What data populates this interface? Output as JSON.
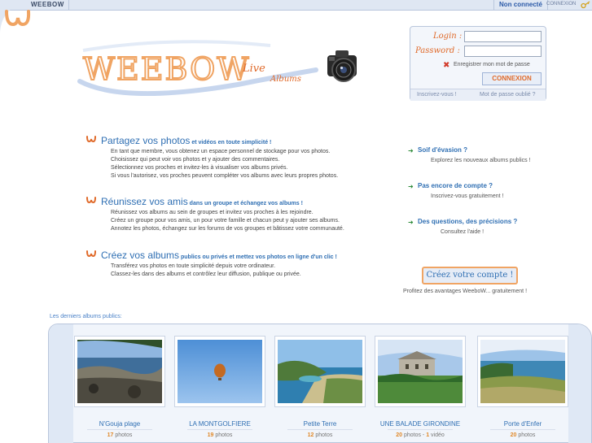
{
  "topbar": {
    "brand": "WEEBOW",
    "status": "Non connecté",
    "connect_link": "CONNEXION"
  },
  "logo": {
    "name": "WEEBOW",
    "tagline_1": "Live",
    "tagline_2": "Albums"
  },
  "login": {
    "login_label": "Login :",
    "password_label": "Password :",
    "login_value": "",
    "password_value": "",
    "remember_label": "Enregistrer mon mot de passe",
    "submit_label": "CONNEXION",
    "register_link": "Inscrivez-vous !",
    "forgot_link": "Mot de passe oublié ?"
  },
  "features": [
    {
      "title": "Partagez vos photos",
      "subtitle": " et vidéos en toute simplicité !",
      "lines": [
        "En tant que membre, vous obtenez un espace personnel de stockage pour vos photos.",
        "Choisissez qui peut voir vos photos et y ajouter des commentaires.",
        "Sélectionnez vos proches et invitez-les à visualiser vos albums privés.",
        "Si vous l'autorisez, vos proches peuvent compléter vos albums avec leurs propres photos."
      ]
    },
    {
      "title": "Réunissez vos amis",
      "subtitle": " dans un groupe et échangez vos albums !",
      "lines": [
        "Réunissez vos albums au sein de groupes et invitez vos proches à les rejoindre.",
        "Créez un groupe pour vos amis, un pour votre famille et chacun peut y ajouter ses albums.",
        "Annotez les photos, échangez sur les forums de vos groupes et bâtissez votre communauté."
      ]
    },
    {
      "title": "Créez vos albums",
      "subtitle": " publics ou privés et mettez vos photos en ligne d'un clic !",
      "lines": [
        "Transférez vos photos en toute simplicité depuis votre ordinateur.",
        "Classez-les dans des albums et contrôlez leur diffusion, publique ou privée."
      ]
    }
  ],
  "side": [
    {
      "title": "Soif d'évasion ?",
      "sub": "Explorez les nouveaux albums publics !"
    },
    {
      "title": "Pas encore de compte ?",
      "sub": "Inscrivez-vous gratuitement !"
    },
    {
      "title": "Des questions, des précisions ?",
      "sub": "Consultez l'aide !"
    }
  ],
  "create": {
    "button": "Créez votre compte !",
    "note": "Profitez des avantages WeeboW... gratuitement !"
  },
  "albums_label": "Les derniers albums publics:",
  "albums": [
    {
      "name": "N'Gouja plage",
      "count": "17",
      "suffix": " photos"
    },
    {
      "name": "LA MONTGOLFIERE",
      "count": "19",
      "suffix": " photos"
    },
    {
      "name": "Petite Terre",
      "count": "12",
      "suffix": " photos"
    },
    {
      "name": "UNE BALADE GIRONDINE",
      "count": "20",
      "suffix": " photos - ",
      "extra_count": "1",
      "extra_suffix": " vidéo"
    },
    {
      "name": "Porte d'Enfer",
      "count": "20",
      "suffix": " photos"
    }
  ],
  "colors": {
    "accent_blue": "#2f6fb3",
    "accent_orange": "#e06a2a",
    "bar": "#dfe7f3"
  }
}
